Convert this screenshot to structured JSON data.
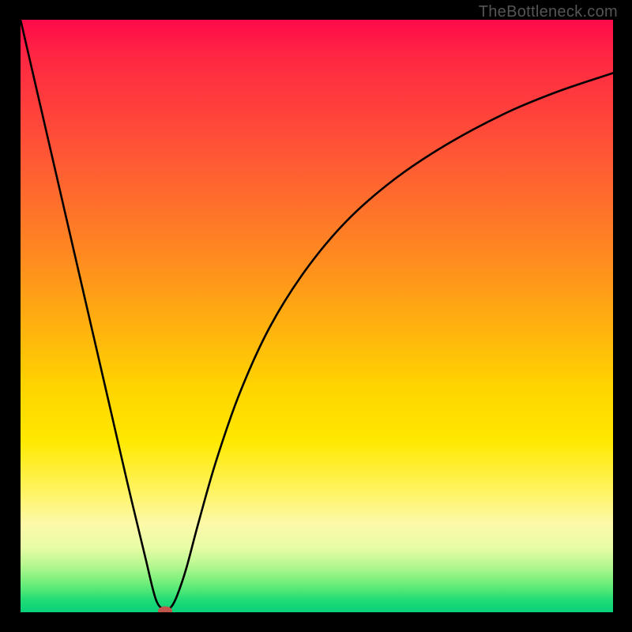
{
  "watermark": "TheBottleneck.com",
  "chart_data": {
    "type": "line",
    "title": "",
    "xlabel": "",
    "ylabel": "",
    "x_range": [
      0,
      1
    ],
    "y_range": [
      0,
      1
    ],
    "series": [
      {
        "name": "curve",
        "x": [
          0.0,
          0.03,
          0.06,
          0.09,
          0.12,
          0.15,
          0.18,
          0.21,
          0.229,
          0.245,
          0.255,
          0.265,
          0.28,
          0.3,
          0.33,
          0.37,
          0.42,
          0.48,
          0.55,
          0.63,
          0.72,
          0.82,
          0.91,
          1.0
        ],
        "y": [
          1.0,
          0.87,
          0.74,
          0.61,
          0.48,
          0.35,
          0.22,
          0.095,
          0.02,
          0.005,
          0.01,
          0.03,
          0.075,
          0.15,
          0.255,
          0.37,
          0.48,
          0.576,
          0.66,
          0.73,
          0.79,
          0.843,
          0.88,
          0.91
        ]
      }
    ],
    "marker": {
      "x": 0.244,
      "y": 0.002,
      "color": "#c0554e"
    },
    "gradient_stops": [
      {
        "pos": 0.0,
        "color": "#ff0a4a"
      },
      {
        "pos": 0.24,
        "color": "#ff5a34"
      },
      {
        "pos": 0.52,
        "color": "#ffb20e"
      },
      {
        "pos": 0.71,
        "color": "#ffe800"
      },
      {
        "pos": 0.89,
        "color": "#e9fca6"
      },
      {
        "pos": 1.0,
        "color": "#08d07a"
      }
    ]
  }
}
